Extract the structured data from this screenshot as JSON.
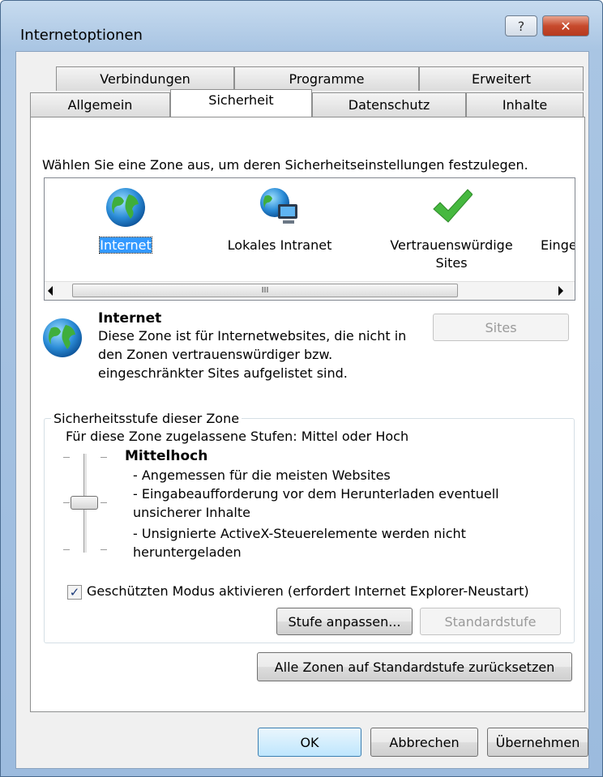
{
  "window": {
    "title": "Internetoptionen"
  },
  "tabs": {
    "row1": [
      "Verbindungen",
      "Programme",
      "Erweitert"
    ],
    "row2": [
      "Allgemein",
      "Sicherheit",
      "Datenschutz",
      "Inhalte"
    ],
    "active": "Sicherheit"
  },
  "zones": {
    "instruction": "Wählen Sie eine Zone aus, um deren Sicherheitseinstellungen festzulegen.",
    "items": [
      {
        "line1": "Internet",
        "line2": "",
        "icon": "globe-icon",
        "selected": true
      },
      {
        "line1": "Lokales Intranet",
        "line2": "",
        "icon": "intranet-icon",
        "selected": false
      },
      {
        "line1": "Vertrauenswürdige",
        "line2": "Sites",
        "icon": "checkmark-icon",
        "selected": false
      },
      {
        "line1": "Einge",
        "line2": "",
        "icon": "",
        "selected": false
      }
    ],
    "scroll_grip": "III"
  },
  "zone_info": {
    "title": "Internet",
    "desc1": "Diese Zone ist für Internetwebsites, die nicht in",
    "desc2": "den Zonen vertrauenswürdiger bzw.",
    "desc3": "eingeschränkter Sites aufgelistet sind.",
    "sites_button": "Sites"
  },
  "security_level": {
    "group_label": "Sicherheitsstufe dieser Zone",
    "allowed": "Für diese Zone zugelassene Stufen: Mittel oder Hoch",
    "level_name": "Mittelhoch",
    "line1": "- Angemessen für die meisten Websites",
    "line2": "- Eingabeaufforderung vor dem Herunterladen eventuell",
    "line3": "unsicherer Inhalte",
    "line4": "- Unsignierte ActiveX-Steuerelemente werden nicht",
    "line5": "heruntergeladen",
    "protected_mode_label": "Geschützten Modus aktivieren (erfordert Internet Explorer-Neustart)",
    "protected_mode_checked": true,
    "checkmark": "✓",
    "custom_button": "Stufe anpassen...",
    "default_button": "Standardstufe"
  },
  "reset_all_button": "Alle Zonen auf Standardstufe zurücksetzen",
  "footer": {
    "ok": "OK",
    "cancel": "Abbrechen",
    "apply": "Übernehmen"
  },
  "colors": {
    "selection": "#3399ff",
    "frame": "#a9c5e3",
    "close": "#c74a2d"
  }
}
